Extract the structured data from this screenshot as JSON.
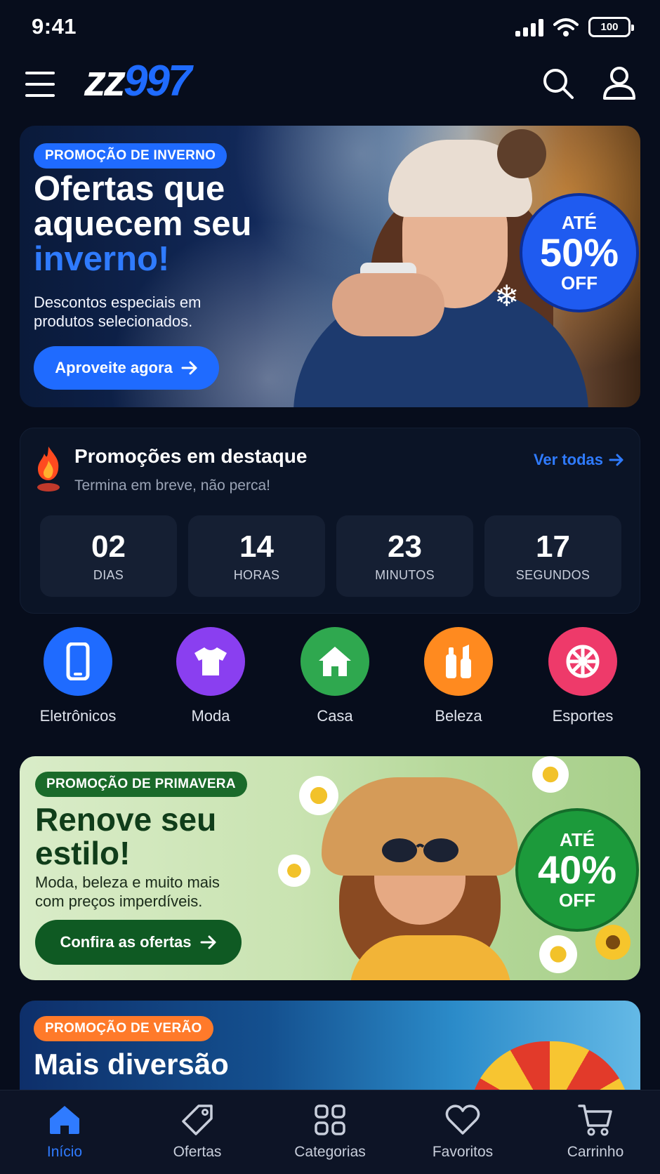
{
  "status": {
    "time": "9:41",
    "battery": "100"
  },
  "header": {
    "logo_part1": "zz",
    "logo_part2": "997"
  },
  "winter_banner": {
    "tag": "PROMOÇÃO DE INVERNO",
    "title_line1": "Ofertas que",
    "title_line2": "aquecem seu",
    "title_accent": "inverno!",
    "subtitle": "Descontos especiais em produtos selecionados.",
    "cta": "Aproveite agora",
    "discount_prefix": "ATÉ",
    "discount_value": "50%",
    "discount_suffix": "OFF"
  },
  "promo": {
    "title": "Promoções em destaque",
    "subtitle": "Termina em breve, não perca!",
    "see_all": "Ver todas",
    "countdown": [
      {
        "value": "02",
        "label": "DIAS"
      },
      {
        "value": "14",
        "label": "HORAS"
      },
      {
        "value": "23",
        "label": "MINUTOS"
      },
      {
        "value": "17",
        "label": "SEGUNDOS"
      }
    ]
  },
  "categories": [
    {
      "label": "Eletrônicos",
      "color": "#1f6bff",
      "icon": "phone-icon"
    },
    {
      "label": "Moda",
      "color": "#8a3ff0",
      "icon": "tshirt-icon"
    },
    {
      "label": "Casa",
      "color": "#2fa84f",
      "icon": "home-icon"
    },
    {
      "label": "Beleza",
      "color": "#ff8a1f",
      "icon": "cosmetics-icon"
    },
    {
      "label": "Esportes",
      "color": "#ee3a6a",
      "icon": "ball-icon"
    }
  ],
  "spring_banner": {
    "tag": "PROMOÇÃO DE PRIMAVERA",
    "title_line1": "Renove seu",
    "title_line2": "estilo!",
    "subtitle_line1": "Moda, beleza e muito mais",
    "subtitle_line2": "com preços imperdíveis.",
    "cta": "Confira as ofertas",
    "discount_prefix": "ATÉ",
    "discount_value": "40%",
    "discount_suffix": "OFF"
  },
  "summer_banner": {
    "tag": "PROMOÇÃO DE VERÃO",
    "title": "Mais diversão"
  },
  "bottom_nav": [
    {
      "label": "Início",
      "icon": "home-icon",
      "active": true
    },
    {
      "label": "Ofertas",
      "icon": "tag-icon",
      "active": false
    },
    {
      "label": "Categorias",
      "icon": "grid-icon",
      "active": false
    },
    {
      "label": "Favoritos",
      "icon": "heart-icon",
      "active": false
    },
    {
      "label": "Carrinho",
      "icon": "cart-icon",
      "active": false
    }
  ],
  "colors": {
    "accent": "#1f6bff",
    "background": "#070d1c",
    "spring_green": "#0f5a23",
    "summer_orange": "#ff7a2a"
  }
}
